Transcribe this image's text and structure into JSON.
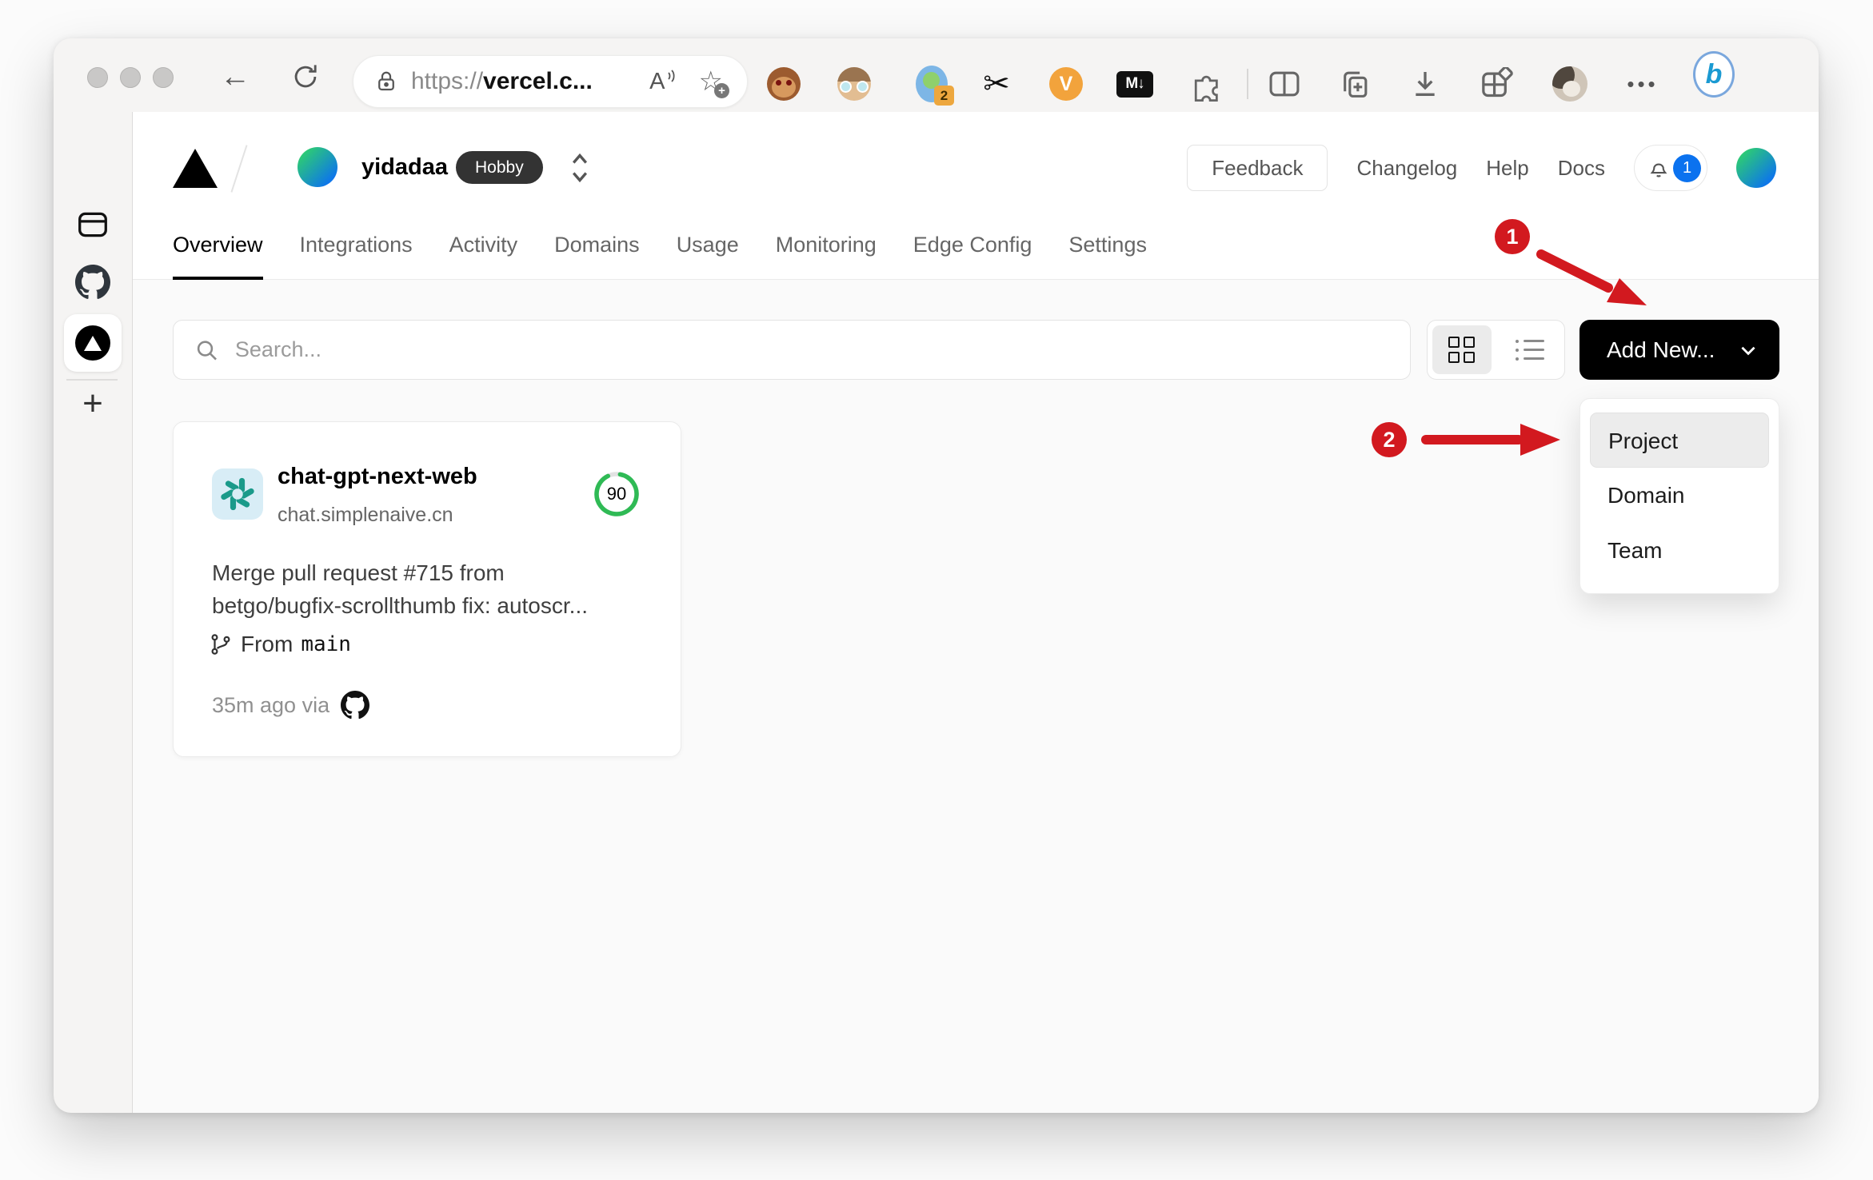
{
  "browser": {
    "url": {
      "scheme": "https://",
      "host": "vercel.c..."
    },
    "ext_badge": "2"
  },
  "glyphs": {
    "back_arrow": "←",
    "reader_mode": "A",
    "star": "☆",
    "star_plus": "+",
    "scissors": "✂",
    "v_ext": "V",
    "markdown_ext": "M↓",
    "menu_dots": "•••",
    "bing": "b",
    "new_tab_plus": "+"
  },
  "header": {
    "team": "yidadaa",
    "plan": "Hobby",
    "feedback": "Feedback",
    "links": [
      "Changelog",
      "Help",
      "Docs"
    ],
    "notifications": "1"
  },
  "nav": {
    "tabs": [
      "Overview",
      "Integrations",
      "Activity",
      "Domains",
      "Usage",
      "Monitoring",
      "Edge Config",
      "Settings"
    ],
    "active": "Overview"
  },
  "toolbar": {
    "search_placeholder": "Search...",
    "add_new": "Add New..."
  },
  "dropdown": {
    "items": [
      "Project",
      "Domain",
      "Team"
    ],
    "highlighted": "Project"
  },
  "card": {
    "name": "chat-gpt-next-web",
    "domain": "chat.simplenaive.cn",
    "score": "90",
    "commit_line1": "Merge pull request #715 from",
    "commit_line2": "betgo/bugfix-scrollthumb fix: autoscr...",
    "from_label": "From",
    "branch": "main",
    "deployed": "35m ago via"
  },
  "annotations": {
    "step1": "1",
    "step2": "2"
  },
  "colors": {
    "accent_red": "#d2191f",
    "badge_blue": "#0b72ef",
    "score_green": "#2fba55",
    "brand_black": "#000000",
    "openai_teal": "#1a9a8a"
  }
}
